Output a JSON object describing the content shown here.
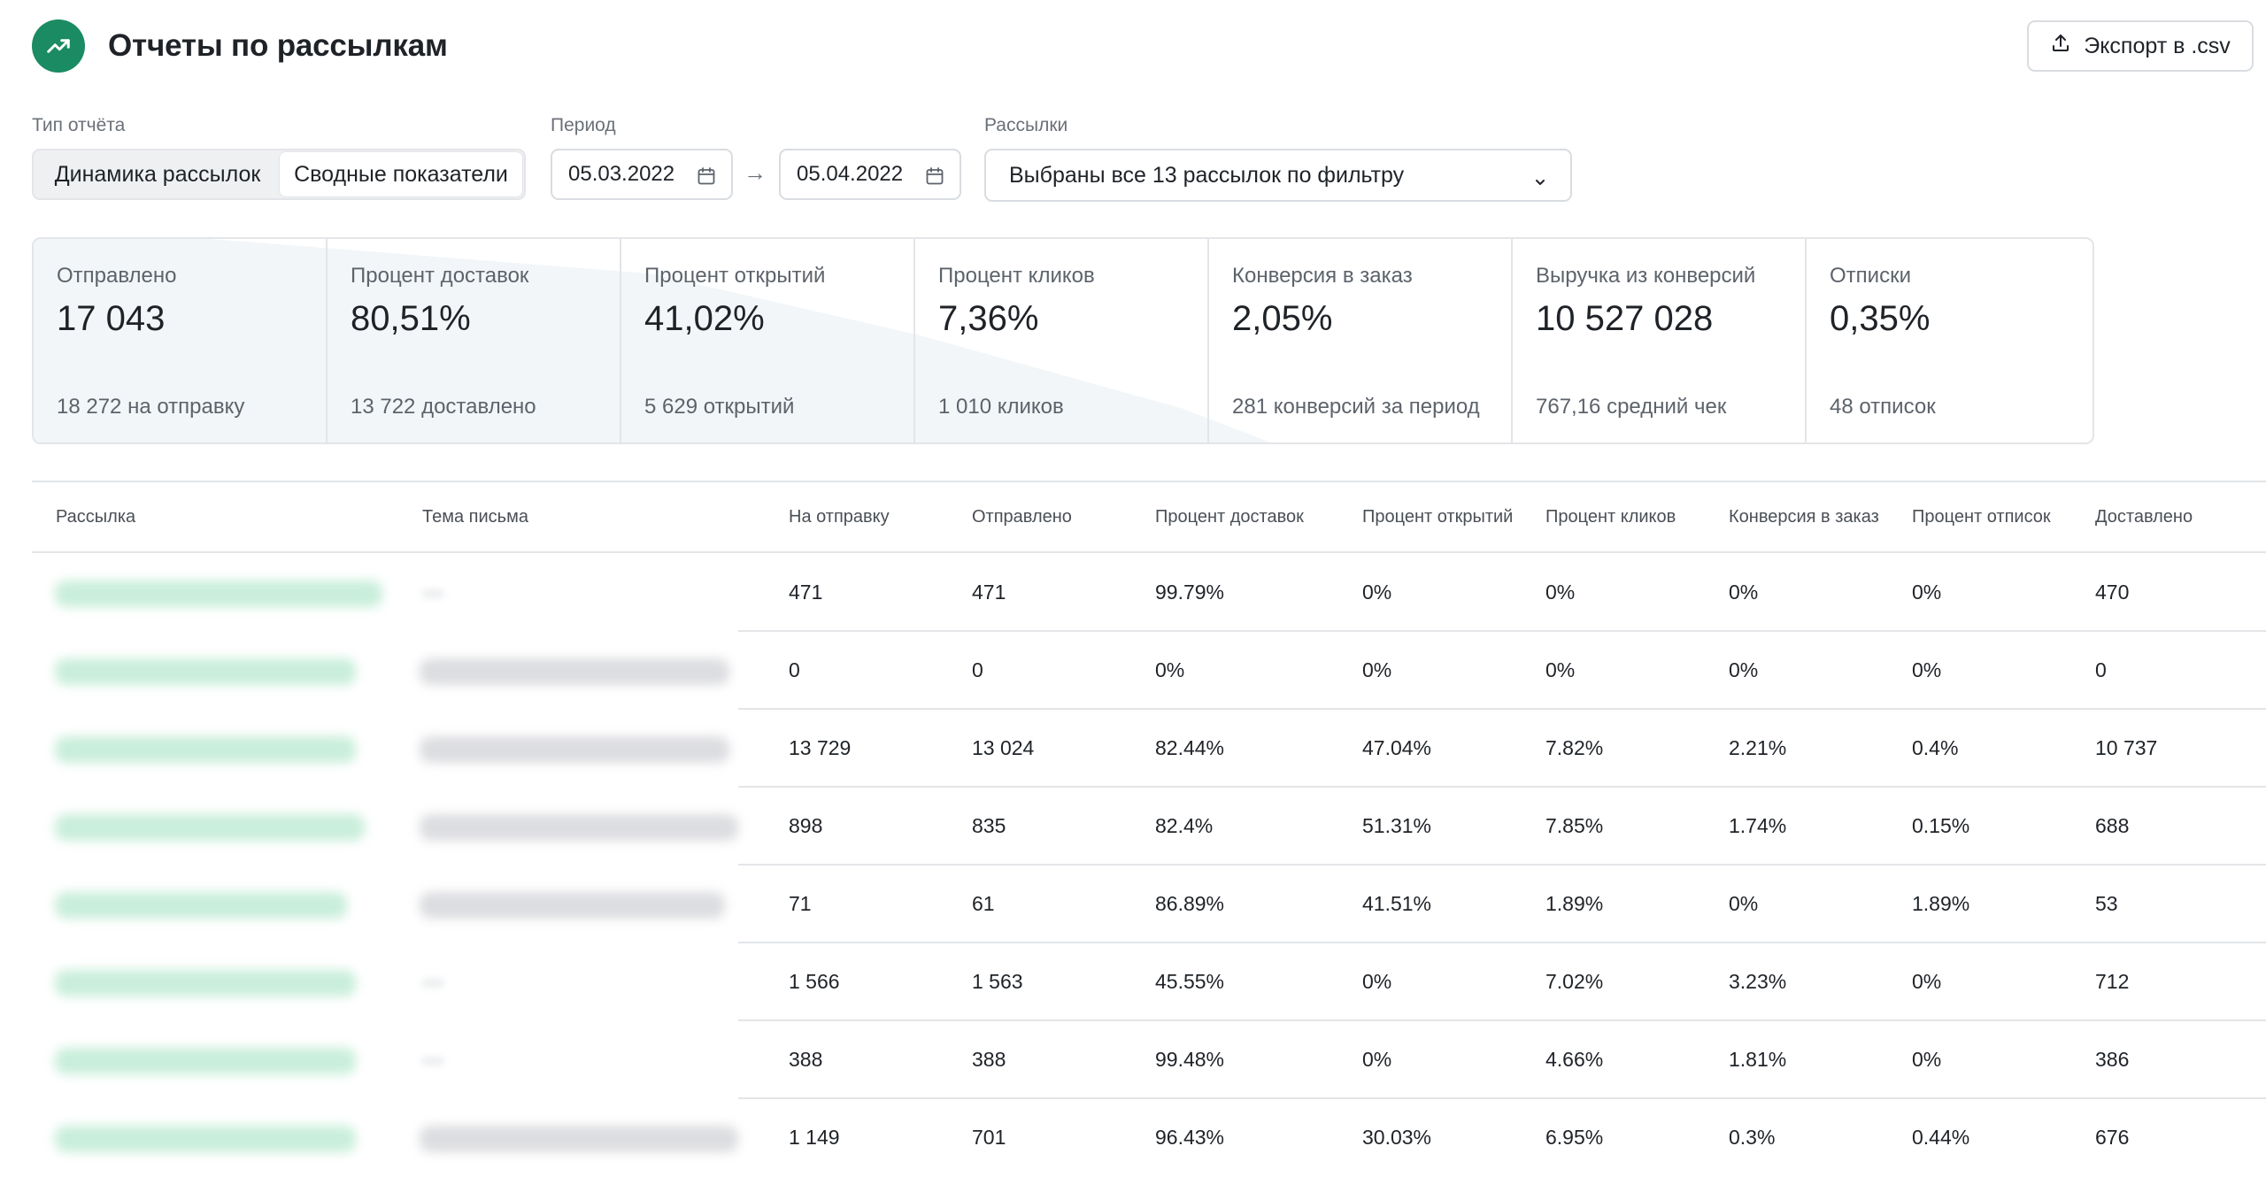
{
  "header": {
    "title": "Отчеты по рассылкам",
    "logo_icon": "trending-up-icon",
    "export_label": "Экспорт в .csv",
    "export_icon": "upload-icon",
    "brand_color": "#1a8b63"
  },
  "filters": {
    "report_type_label": "Тип отчёта",
    "report_types": [
      "Динамика рассылок",
      "Сводные показатели"
    ],
    "active_report_type": "Сводные показатели",
    "period_label": "Период",
    "date_from": "05.03.2022",
    "date_to": "05.04.2022",
    "mailings_label": "Рассылки",
    "mailings_value": "Выбраны все 13 рассылок по фильтру"
  },
  "stats": [
    {
      "label": "Отправлено",
      "value": "17 043",
      "sub": "18 272 на отправку"
    },
    {
      "label": "Процент доставок",
      "value": "80,51%",
      "sub": "13 722 доставлено"
    },
    {
      "label": "Процент открытий",
      "value": "41,02%",
      "sub": "5 629 открытий"
    },
    {
      "label": "Процент кликов",
      "value": "7,36%",
      "sub": "1 010 кликов"
    },
    {
      "label": "Конверсия в заказ",
      "value": "2,05%",
      "sub": "281 конверсий за период"
    },
    {
      "label": "Выручка из конверсий",
      "value": "10 527 028",
      "sub": "767,16 средний чек"
    },
    {
      "label": "Отписки",
      "value": "0,35%",
      "sub": "48 отписок"
    }
  ],
  "table": {
    "headers": [
      "Рассылка",
      "Тема письма",
      "На отправку",
      "Отправлено",
      "Процент доставок",
      "Процент открытий",
      "Процент кликов",
      "Конверсия в заказ",
      "Процент отписок",
      "Доставлено"
    ],
    "rows": [
      [
        "471",
        "471",
        "99.79%",
        "0%",
        "0%",
        "0%",
        "0%",
        "470"
      ],
      [
        "0",
        "0",
        "0%",
        "0%",
        "0%",
        "0%",
        "0%",
        "0"
      ],
      [
        "13 729",
        "13 024",
        "82.44%",
        "47.04%",
        "7.82%",
        "2.21%",
        "0.4%",
        "10 737"
      ],
      [
        "898",
        "835",
        "82.4%",
        "51.31%",
        "7.85%",
        "1.74%",
        "0.15%",
        "688"
      ],
      [
        "71",
        "61",
        "86.89%",
        "41.51%",
        "1.89%",
        "0%",
        "1.89%",
        "53"
      ],
      [
        "1 566",
        "1 563",
        "45.55%",
        "0%",
        "7.02%",
        "3.23%",
        "0%",
        "712"
      ],
      [
        "388",
        "388",
        "99.48%",
        "0%",
        "4.66%",
        "1.81%",
        "0%",
        "386"
      ],
      [
        "1 149",
        "701",
        "96.43%",
        "30.03%",
        "6.95%",
        "0.3%",
        "0.44%",
        "676"
      ]
    ]
  }
}
